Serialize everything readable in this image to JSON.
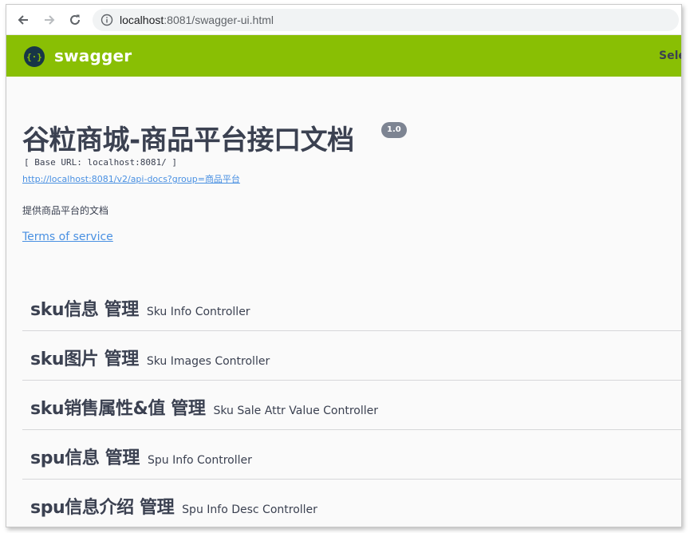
{
  "browser": {
    "url_host": "localhost",
    "url_rest": ":8081/swagger-ui.html"
  },
  "topbar": {
    "logo_text": "swagger",
    "select_label": "Sele"
  },
  "info": {
    "title": "谷粒商城-商品平台接口文档",
    "version": "1.0",
    "base_url": "[ Base URL: localhost:8081/ ]",
    "api_docs_link": "http://localhost:8081/v2/api-docs?group=商品平台",
    "description": "提供商品平台的文档",
    "terms_label": "Terms of service"
  },
  "tags": [
    {
      "name": "sku信息 管理",
      "description": "Sku Info Controller"
    },
    {
      "name": "sku图片 管理",
      "description": "Sku Images Controller"
    },
    {
      "name": "sku销售属性&值 管理",
      "description": "Sku Sale Attr Value Controller"
    },
    {
      "name": "spu信息 管理",
      "description": "Spu Info Controller"
    },
    {
      "name": "spu信息介绍 管理",
      "description": "Spu Info Desc Controller"
    }
  ],
  "colors": {
    "topbar": "#89bf04",
    "link": "#4990e2",
    "text": "#3b4151",
    "badge": "#7d8492"
  },
  "icons": [
    "back-arrow-icon",
    "forward-arrow-icon",
    "reload-icon",
    "info-icon",
    "swagger-logo-icon"
  ]
}
